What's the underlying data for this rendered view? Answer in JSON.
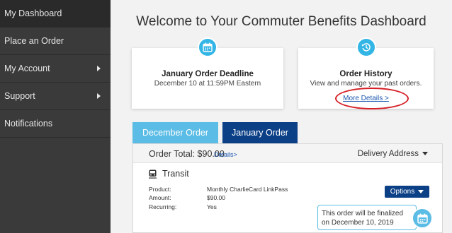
{
  "sidebar": {
    "items": [
      {
        "label": "My Dashboard"
      },
      {
        "label": "Place an Order"
      },
      {
        "label": "My Account"
      },
      {
        "label": "Support"
      },
      {
        "label": "Notifications"
      }
    ]
  },
  "header": {
    "title": "Welcome to Your Commuter Benefits Dashboard"
  },
  "cards": {
    "deadline": {
      "title": "January Order Deadline",
      "subtitle": "December 10 at 11:59PM Eastern",
      "icon": "calendar-icon"
    },
    "history": {
      "title": "Order History",
      "subtitle": "View and manage your past orders.",
      "link": "More Details >",
      "icon": "history-icon"
    }
  },
  "tabs": [
    {
      "label": "December Order"
    },
    {
      "label": "January Order"
    }
  ],
  "order": {
    "total_label": "Order Total: $90.00",
    "details_link": "Details>",
    "delivery_label": "Delivery Address",
    "section": "Transit",
    "fields": [
      {
        "label": "Product:",
        "value": "Monthly CharlieCard LinkPass"
      },
      {
        "label": "Amount:",
        "value": "$90.00"
      },
      {
        "label": "Recurring:",
        "value": "Yes"
      }
    ],
    "options_label": "Options",
    "final_line1": "This order will be finalized",
    "final_line2": "on December 10, 2019"
  },
  "colors": {
    "sidebar": "#3a3a3a",
    "accent": "#33b5e5",
    "tab_active": "#0b3f86",
    "tab_inactive": "#5bbce5",
    "highlight": "#d61f26"
  }
}
